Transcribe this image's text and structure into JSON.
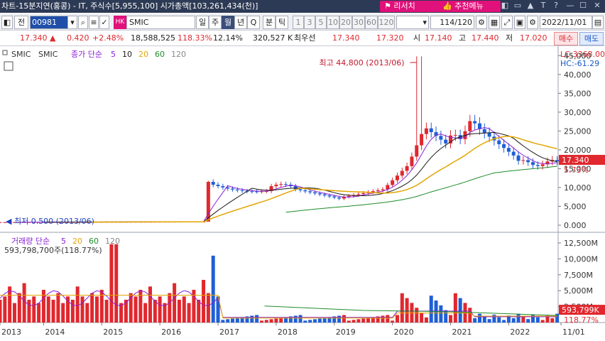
{
  "window": {
    "title": "차트-15분지연(홍콩) - IT, 주식수[5,955,100] 시가총액[103,261,434(천)]",
    "research_label": "리서치",
    "recommend_label": "추천메뉴",
    "controls": [
      "◧",
      "▭",
      "▲",
      "T",
      "?",
      "—",
      "☐",
      "✕"
    ]
  },
  "toolbar": {
    "jeon_label": "전",
    "code": "00981",
    "market_badge": "HK",
    "stock_name": "SMIC",
    "period_buttons": [
      "일",
      "주",
      "월",
      "년",
      "Q"
    ],
    "selected_period": "월",
    "minute_buttons": [
      "분",
      "틱"
    ],
    "number_buttons": [
      "1",
      "3",
      "5",
      "10",
      "20",
      "30",
      "60",
      "120"
    ],
    "count": "114/120",
    "date": "2022/11/01"
  },
  "quote": {
    "price": "17.340",
    "change": "0.420",
    "change_pct": "+2.48%",
    "volume": "18,588,525",
    "volume_ratio": "118.33%",
    "turnover": "12.14%",
    "amount": "320,527 K",
    "best_bid_label": "최우선",
    "best_ask": "17.340",
    "best_bid": "17.320",
    "open_label": "시",
    "open": "17.140",
    "high_label": "고",
    "high": "17.440",
    "low_label": "저",
    "low": "17.020",
    "buy_label": "매수",
    "sell_label": "매도"
  },
  "chart_data": [
    {
      "type": "candlestick",
      "header": {
        "names": [
          "SMIC",
          "SMIC"
        ],
        "ma_label": "종가 단순",
        "ma_periods": [
          "5",
          "10",
          "20",
          "60",
          "120"
        ],
        "lc": "LC:3368.00",
        "hc": "HC:-61.29"
      },
      "y_ticks": [
        "45,000",
        "40,000",
        "35,000",
        "30,000",
        "25,000",
        "20,000",
        "15,000",
        "10,000",
        "5,000",
        "0.000"
      ],
      "ylim": [
        0,
        46000
      ],
      "high_annotation": "최고 44,800 (2013/06)",
      "low_annotation": "최저 0.500 (2013/06)",
      "current_label": "17.340",
      "current_pct": "5.73%",
      "series": [
        {
          "name": "5",
          "color": "#8b1fd6"
        },
        {
          "name": "10",
          "color": "#1a1a1a"
        },
        {
          "name": "20",
          "color": "#e3a500"
        },
        {
          "name": "60",
          "color": "#1f8c2a"
        }
      ],
      "up_color": "#e0282e",
      "down_color": "#1f5fd6"
    },
    {
      "type": "bar",
      "header": {
        "label": "거래량 단순",
        "ma_periods": [
          "5",
          "20",
          "60",
          "120"
        ],
        "value": "593,798,700주(118.77%)"
      },
      "y_ticks": [
        "12,500M",
        "10,000M",
        "7,500M",
        "5,000M",
        "2,500M"
      ],
      "ylim": [
        0,
        13500
      ],
      "current_label": "593,799K",
      "current_pct": "118.77%"
    }
  ],
  "x_axis": [
    "2013",
    "2014",
    "2015",
    "2016",
    "2017",
    "2018",
    "2019",
    "2020",
    "2021",
    "2022",
    "11/01"
  ]
}
